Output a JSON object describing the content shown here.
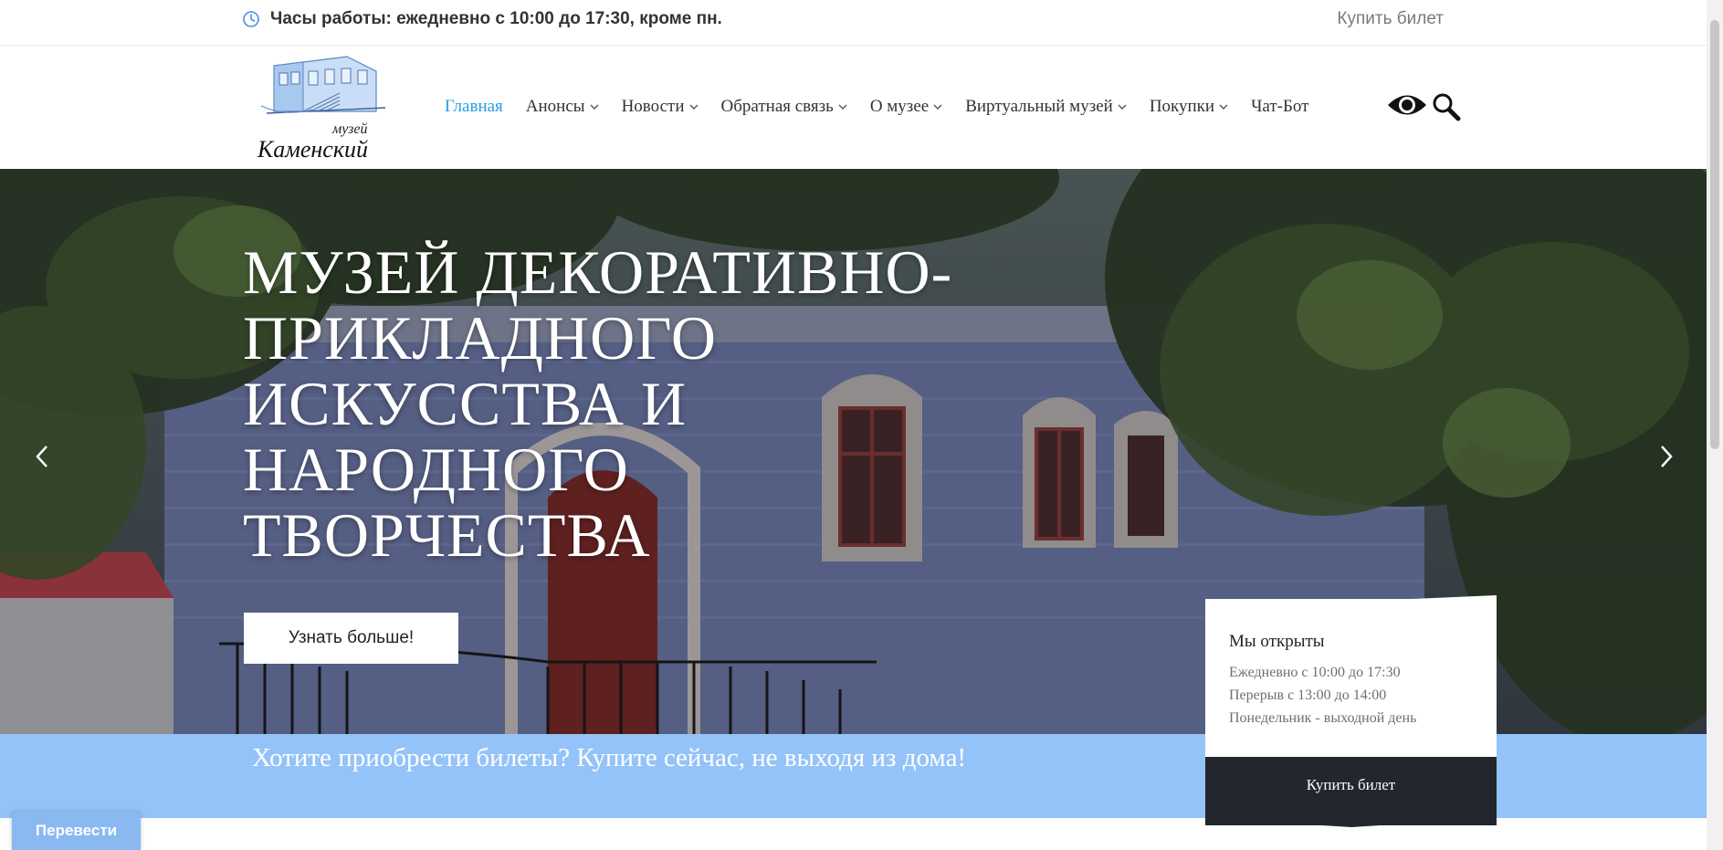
{
  "topbar": {
    "hours": "Часы работы: ежедневно с 10:00 до 17:30, кроме пн.",
    "buy_ticket": "Купить билет"
  },
  "logo": {
    "line1": "музей",
    "line2": "Каменский"
  },
  "nav": {
    "items": [
      {
        "label": "Главная",
        "active": true,
        "dropdown": false
      },
      {
        "label": "Анонсы",
        "active": false,
        "dropdown": true
      },
      {
        "label": "Новости",
        "active": false,
        "dropdown": true
      },
      {
        "label": "Обратная связь",
        "active": false,
        "dropdown": true
      },
      {
        "label": "О музее",
        "active": false,
        "dropdown": true
      },
      {
        "label": "Виртуальный музей",
        "active": false,
        "dropdown": true
      },
      {
        "label": "Покупки",
        "active": false,
        "dropdown": true
      },
      {
        "label": "Чат-Бот",
        "active": false,
        "dropdown": false
      }
    ]
  },
  "hero": {
    "title": "МУЗЕЙ ДЕКОРАТИВНО-ПРИКЛАДНОГО ИСКУССТВА И НАРОДНОГО ТВОРЧЕСТВА",
    "button": "Узнать больше!"
  },
  "band": {
    "text": "Хотите приобрести билеты? Купите сейчас, не выходя из дома!"
  },
  "open_card": {
    "title": "Мы открыты",
    "lines": [
      "Ежедневно с 10:00 до 17:30",
      "Перерыв с 13:00 до 14:00",
      "Понедельник - выходной день"
    ],
    "buy": "Купить билет"
  },
  "translate": {
    "label": "Перевести"
  },
  "icons": {
    "clock": "clock-icon",
    "eye": "eye-icon",
    "search": "search-icon",
    "prev": "chevron-left-icon",
    "next": "chevron-right-icon"
  },
  "colors": {
    "accent": "#2a9be0",
    "band": "#94c3f9",
    "dark": "#24262d"
  }
}
